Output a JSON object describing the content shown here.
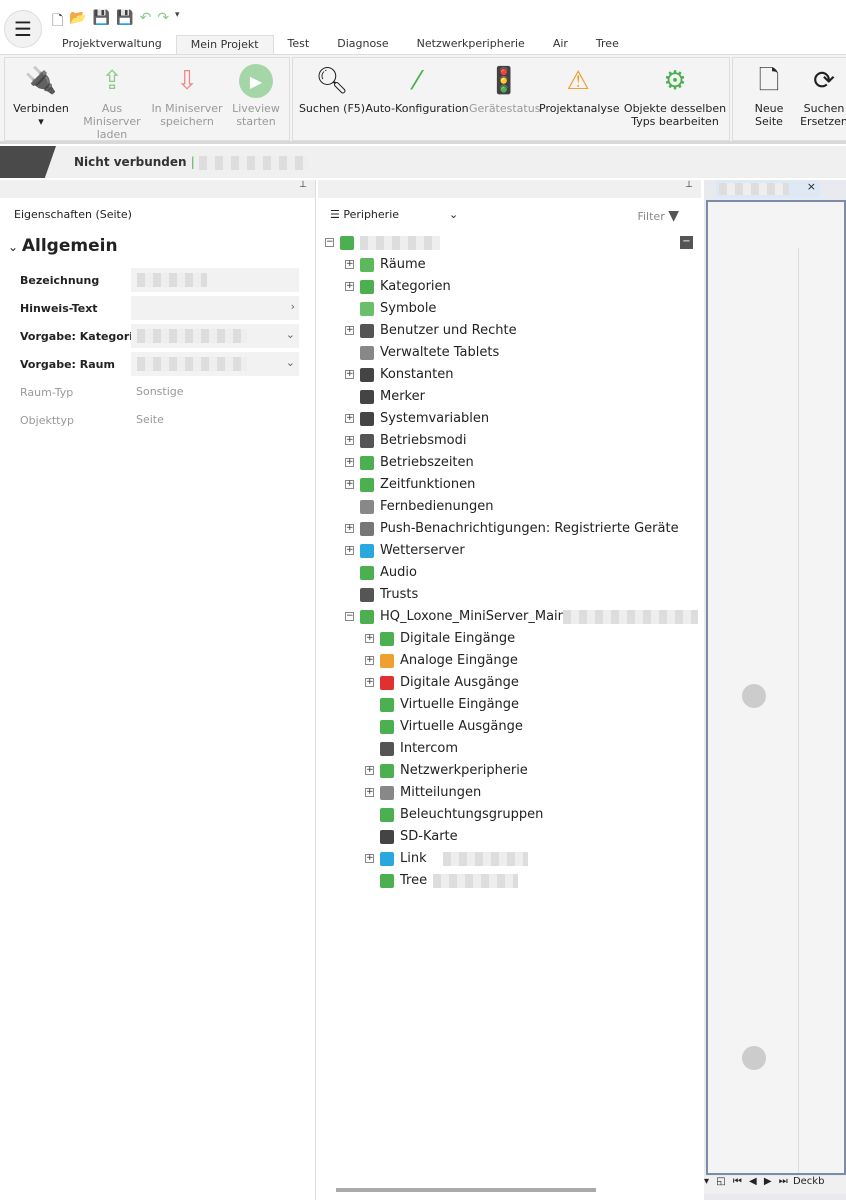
{
  "quick_access": [
    "new-file-icon",
    "open-folder-icon",
    "save-icon",
    "save-as-icon",
    "undo-icon",
    "redo-icon",
    "customize-icon"
  ],
  "tabs": [
    "Projektverwaltung",
    "Mein Projekt",
    "Test",
    "Diagnose",
    "Netzwerkperipherie",
    "Air",
    "Tree"
  ],
  "active_tab": "Mein Projekt",
  "ribbon": {
    "connect": "Verbinden",
    "load": "Aus Miniserver laden",
    "save": "In Miniserver speichern",
    "liveview": "Liveview starten",
    "search": "Suchen (F5)",
    "autoconfig": "Auto-Konfiguration",
    "devstatus": "Gerätestatus",
    "analysis": "Projektanalyse",
    "edit_same": "Objekte desselben Typs bearbeiten",
    "new_page": "Neue Seite",
    "search_replace": "Suchen Ersetzen"
  },
  "status": {
    "text": "Nicht verbunden",
    "separator": "|"
  },
  "properties": {
    "title": "Eigenschaften (Seite)",
    "section": "Allgemein",
    "rows": [
      {
        "label": "Bezeichnung",
        "value": ""
      },
      {
        "label": "Hinweis-Text",
        "value": ""
      },
      {
        "label": "Vorgabe: Kategorie",
        "value": ""
      },
      {
        "label": "Vorgabe: Raum",
        "value": ""
      },
      {
        "label": "Raum-Typ",
        "value": "Sonstige"
      },
      {
        "label": "Objekttyp",
        "value": "Seite"
      }
    ]
  },
  "periphery": {
    "dropdown": "Peripherie",
    "filter": "Filter",
    "tree": [
      {
        "level": 0,
        "label": "",
        "icon": "#4caf50",
        "exp": "−"
      },
      {
        "level": 1,
        "label": "Räume",
        "icon": "#5cb85c",
        "exp": "+"
      },
      {
        "level": 1,
        "label": "Kategorien",
        "icon": "#4caf50",
        "exp": "+"
      },
      {
        "level": 1,
        "label": "Symbole",
        "icon": "#6abf69",
        "exp": ""
      },
      {
        "level": 1,
        "label": "Benutzer und Rechte",
        "icon": "#555",
        "exp": "+"
      },
      {
        "level": 1,
        "label": "Verwaltete Tablets",
        "icon": "#888",
        "exp": ""
      },
      {
        "level": 1,
        "label": "Konstanten",
        "icon": "#444",
        "exp": "+"
      },
      {
        "level": 1,
        "label": "Merker",
        "icon": "#444",
        "exp": ""
      },
      {
        "level": 1,
        "label": "Systemvariablen",
        "icon": "#444",
        "exp": "+"
      },
      {
        "level": 1,
        "label": "Betriebsmodi",
        "icon": "#555",
        "exp": "+"
      },
      {
        "level": 1,
        "label": "Betriebszeiten",
        "icon": "#4caf50",
        "exp": "+"
      },
      {
        "level": 1,
        "label": "Zeitfunktionen",
        "icon": "#4caf50",
        "exp": "+"
      },
      {
        "level": 1,
        "label": "Fernbedienungen",
        "icon": "#888",
        "exp": ""
      },
      {
        "level": 1,
        "label": "Push-Benachrichtigungen: Registrierte Geräte",
        "icon": "#777",
        "exp": "+"
      },
      {
        "level": 1,
        "label": "Wetterserver",
        "icon": "#29a8e0",
        "exp": "+"
      },
      {
        "level": 1,
        "label": "Audio",
        "icon": "#4caf50",
        "exp": ""
      },
      {
        "level": 1,
        "label": "Trusts",
        "icon": "#555",
        "exp": ""
      },
      {
        "level": 1,
        "label": "HQ_Loxone_MiniServer_Main",
        "icon": "#4caf50",
        "exp": "−"
      },
      {
        "level": 2,
        "label": "Digitale Eingänge",
        "icon": "#4caf50",
        "exp": "+"
      },
      {
        "level": 2,
        "label": "Analoge Eingänge",
        "icon": "#f0a030",
        "exp": "+"
      },
      {
        "level": 2,
        "label": "Digitale Ausgänge",
        "icon": "#e03030",
        "exp": "+"
      },
      {
        "level": 2,
        "label": "Virtuelle Eingänge",
        "icon": "#4caf50",
        "exp": ""
      },
      {
        "level": 2,
        "label": "Virtuelle Ausgänge",
        "icon": "#4caf50",
        "exp": ""
      },
      {
        "level": 2,
        "label": "Intercom",
        "icon": "#555",
        "exp": ""
      },
      {
        "level": 2,
        "label": "Netzwerkperipherie",
        "icon": "#4caf50",
        "exp": "+"
      },
      {
        "level": 2,
        "label": "Mitteilungen",
        "icon": "#888",
        "exp": "+"
      },
      {
        "level": 2,
        "label": "Beleuchtungsgruppen",
        "icon": "#4caf50",
        "exp": ""
      },
      {
        "level": 2,
        "label": "SD-Karte",
        "icon": "#444",
        "exp": ""
      },
      {
        "level": 2,
        "label": "Link",
        "icon": "#29a8e0",
        "exp": "+"
      },
      {
        "level": 2,
        "label": "Tree",
        "icon": "#4caf50",
        "exp": ""
      }
    ]
  },
  "document": {
    "close": "×",
    "sheet_tab": "Deckb"
  },
  "colors": {
    "accent_green": "#4caf50",
    "ribbon_bg": "#f4f4f4"
  }
}
